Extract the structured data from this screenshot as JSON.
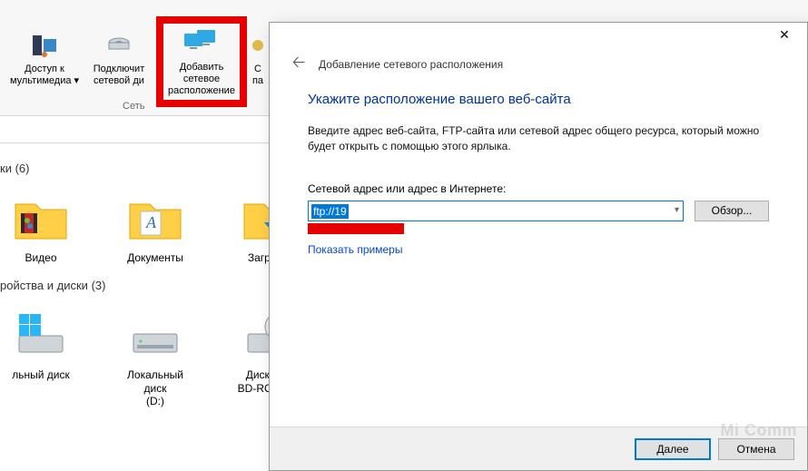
{
  "ribbon": {
    "buttons": [
      {
        "line1": "Доступ к",
        "line2": "мультимедиа"
      },
      {
        "line1": "Подключит",
        "line2": "сетевой ди"
      },
      {
        "line1": "Добавить сетевое",
        "line2": "расположение"
      },
      {
        "line1": "С",
        "line2": "па"
      }
    ],
    "group_label": "Сеть"
  },
  "explorer": {
    "section1_title": "ки",
    "section1_count": "(6)",
    "section2_title": "ройства и диски",
    "section2_count": "(3)",
    "items1": [
      {
        "name": "Видео"
      },
      {
        "name": "Документы"
      },
      {
        "name": "Загрузки"
      }
    ],
    "items2": [
      {
        "name": "льный диск"
      },
      {
        "name1": "Локальный диск",
        "name2": "(D:)"
      },
      {
        "name1": "Дисковод",
        "name2": "BD-ROM (F:)"
      }
    ]
  },
  "wizard": {
    "breadcrumb": "Добавление сетевого расположения",
    "heading": "Укажите расположение вашего веб-сайта",
    "desc": "Введите адрес веб-сайта, FTP-сайта или сетевой адрес общего ресурса, который можно будет открыть с помощью этого ярлыка.",
    "field_label": "Сетевой адрес или адрес в Интернете:",
    "input_value": "ftp://19",
    "browse_btn": "Обзор...",
    "examples_link": "Показать примеры",
    "next_btn": "Далее",
    "cancel_btn": "Отмена",
    "close_label": "✕"
  },
  "watermark": "Mi Comm"
}
